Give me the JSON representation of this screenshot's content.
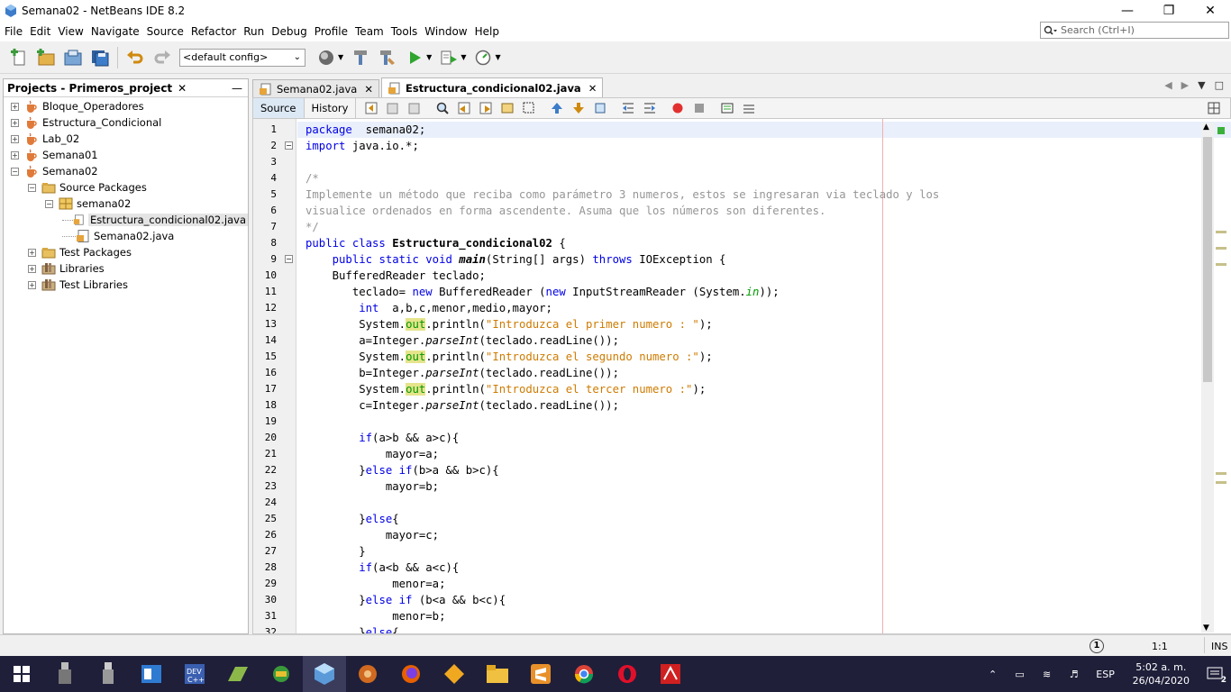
{
  "window": {
    "title": "Semana02 - NetBeans IDE 8.2"
  },
  "menu": [
    "File",
    "Edit",
    "View",
    "Navigate",
    "Source",
    "Refactor",
    "Run",
    "Debug",
    "Profile",
    "Team",
    "Tools",
    "Window",
    "Help"
  ],
  "search": {
    "placeholder": "Search (Ctrl+I)"
  },
  "toolbar": {
    "config": "<default config>"
  },
  "projects": {
    "title": "Projects - Primeros_project",
    "tree": [
      {
        "label": "Bloque_Operadores",
        "depth": 0,
        "toggle": "+",
        "icon": "project"
      },
      {
        "label": "Estructura_Condicional",
        "depth": 0,
        "toggle": "+",
        "icon": "project"
      },
      {
        "label": "Lab_02",
        "depth": 0,
        "toggle": "+",
        "icon": "project"
      },
      {
        "label": "Semana01",
        "depth": 0,
        "toggle": "+",
        "icon": "project"
      },
      {
        "label": "Semana02",
        "depth": 0,
        "toggle": "−",
        "icon": "project"
      },
      {
        "label": "Source Packages",
        "depth": 1,
        "toggle": "−",
        "icon": "folder"
      },
      {
        "label": "semana02",
        "depth": 2,
        "toggle": "−",
        "icon": "package"
      },
      {
        "label": "Estructura_condicional02.java",
        "depth": 3,
        "toggle": "",
        "icon": "java",
        "selected": true
      },
      {
        "label": "Semana02.java",
        "depth": 3,
        "toggle": "",
        "icon": "java"
      },
      {
        "label": "Test Packages",
        "depth": 1,
        "toggle": "+",
        "icon": "folder"
      },
      {
        "label": "Libraries",
        "depth": 1,
        "toggle": "+",
        "icon": "library"
      },
      {
        "label": "Test Libraries",
        "depth": 1,
        "toggle": "+",
        "icon": "library"
      }
    ]
  },
  "tabs": [
    {
      "label": "Semana02.java",
      "active": false
    },
    {
      "label": "Estructura_condicional02.java",
      "active": true
    }
  ],
  "editor_modes": {
    "source": "Source",
    "history": "History"
  },
  "line_numbers": [
    "1",
    "2",
    "3",
    "4",
    "5",
    "6",
    "7",
    "8",
    "9",
    "10",
    "11",
    "12",
    "13",
    "14",
    "15",
    "16",
    "17",
    "18",
    "19",
    "20",
    "21",
    "22",
    "23",
    "24",
    "25",
    "26",
    "27",
    "28",
    "29",
    "30",
    "31",
    "32"
  ],
  "code": [
    [
      [
        "kw",
        "package"
      ],
      [
        "",
        "  semana02;"
      ]
    ],
    [
      [
        "kw",
        "import"
      ],
      [
        "",
        " java.io.*;"
      ]
    ],
    [],
    [
      [
        "cm",
        "/*"
      ]
    ],
    [
      [
        "cm",
        "Implemente un método que reciba como parámetro 3 numeros, estos se ingresaran via teclado y los"
      ]
    ],
    [
      [
        "cm",
        "visualice ordenados en forma ascendente. Asuma que los números son diferentes."
      ]
    ],
    [
      [
        "cm",
        "*/"
      ]
    ],
    [
      [
        "kw",
        "public class "
      ],
      [
        "cls",
        "Estructura_condicional02"
      ],
      [
        "",
        " {"
      ]
    ],
    [
      [
        "",
        "    "
      ],
      [
        "kw",
        "public static void "
      ],
      [
        "mth-b",
        "main"
      ],
      [
        "",
        "(String[] args) "
      ],
      [
        "kw",
        "throws"
      ],
      [
        "",
        " IOException {"
      ]
    ],
    [
      [
        "",
        "    BufferedReader teclado;"
      ]
    ],
    [
      [
        "",
        "       teclado= "
      ],
      [
        "kw",
        "new"
      ],
      [
        "",
        " BufferedReader ("
      ],
      [
        "kw",
        "new"
      ],
      [
        "",
        " InputStreamReader (System."
      ],
      [
        "fld2",
        "in"
      ],
      [
        "",
        "));"
      ]
    ],
    [
      [
        "",
        "        "
      ],
      [
        "kw",
        "int"
      ],
      [
        "",
        "  a,b,c,menor,medio,mayor;"
      ]
    ],
    [
      [
        "",
        "        System."
      ],
      [
        "fld",
        "out"
      ],
      [
        "",
        ".println("
      ],
      [
        "str",
        "\"Introduzca el primer numero : \""
      ],
      [
        "",
        ");"
      ]
    ],
    [
      [
        "",
        "        a=Integer."
      ],
      [
        "mtd",
        "parseInt"
      ],
      [
        "",
        "(teclado.readLine());"
      ]
    ],
    [
      [
        "",
        "        System."
      ],
      [
        "fld",
        "out"
      ],
      [
        "",
        ".println("
      ],
      [
        "str",
        "\"Introduzca el segundo numero :\""
      ],
      [
        "",
        ");"
      ]
    ],
    [
      [
        "",
        "        b=Integer."
      ],
      [
        "mtd",
        "parseInt"
      ],
      [
        "",
        "(teclado.readLine());"
      ]
    ],
    [
      [
        "",
        "        System."
      ],
      [
        "fld",
        "out"
      ],
      [
        "",
        ".println("
      ],
      [
        "str",
        "\"Introduzca el tercer numero :\""
      ],
      [
        "",
        ");"
      ]
    ],
    [
      [
        "",
        "        c=Integer."
      ],
      [
        "mtd",
        "parseInt"
      ],
      [
        "",
        "(teclado.readLine());"
      ]
    ],
    [],
    [
      [
        "",
        "        "
      ],
      [
        "kw",
        "if"
      ],
      [
        "",
        "(a>b && a>c){"
      ]
    ],
    [
      [
        "",
        "            mayor=a;"
      ]
    ],
    [
      [
        "",
        "        }"
      ],
      [
        "kw",
        "else if"
      ],
      [
        "",
        "(b>a && b>c){"
      ]
    ],
    [
      [
        "",
        "            mayor=b;"
      ]
    ],
    [],
    [
      [
        "",
        "        }"
      ],
      [
        "kw",
        "else"
      ],
      [
        "",
        "{"
      ]
    ],
    [
      [
        "",
        "            mayor=c;"
      ]
    ],
    [
      [
        "",
        "        }"
      ]
    ],
    [
      [
        "",
        "        "
      ],
      [
        "kw",
        "if"
      ],
      [
        "",
        "(a<b && a<c){"
      ]
    ],
    [
      [
        "",
        "             menor=a;"
      ]
    ],
    [
      [
        "",
        "        }"
      ],
      [
        "kw",
        "else if"
      ],
      [
        "",
        " (b<a && b<c){"
      ]
    ],
    [
      [
        "",
        "             menor=b;"
      ]
    ],
    [
      [
        "",
        "        }"
      ],
      [
        "kw",
        "else"
      ],
      [
        "",
        "{"
      ]
    ]
  ],
  "status": {
    "position": "1:1",
    "mode": "INS",
    "notifications": "1"
  },
  "tray": {
    "language": "ESP",
    "time": "5:02 a. m.",
    "date": "26/04/2020",
    "notification_count": "2"
  }
}
